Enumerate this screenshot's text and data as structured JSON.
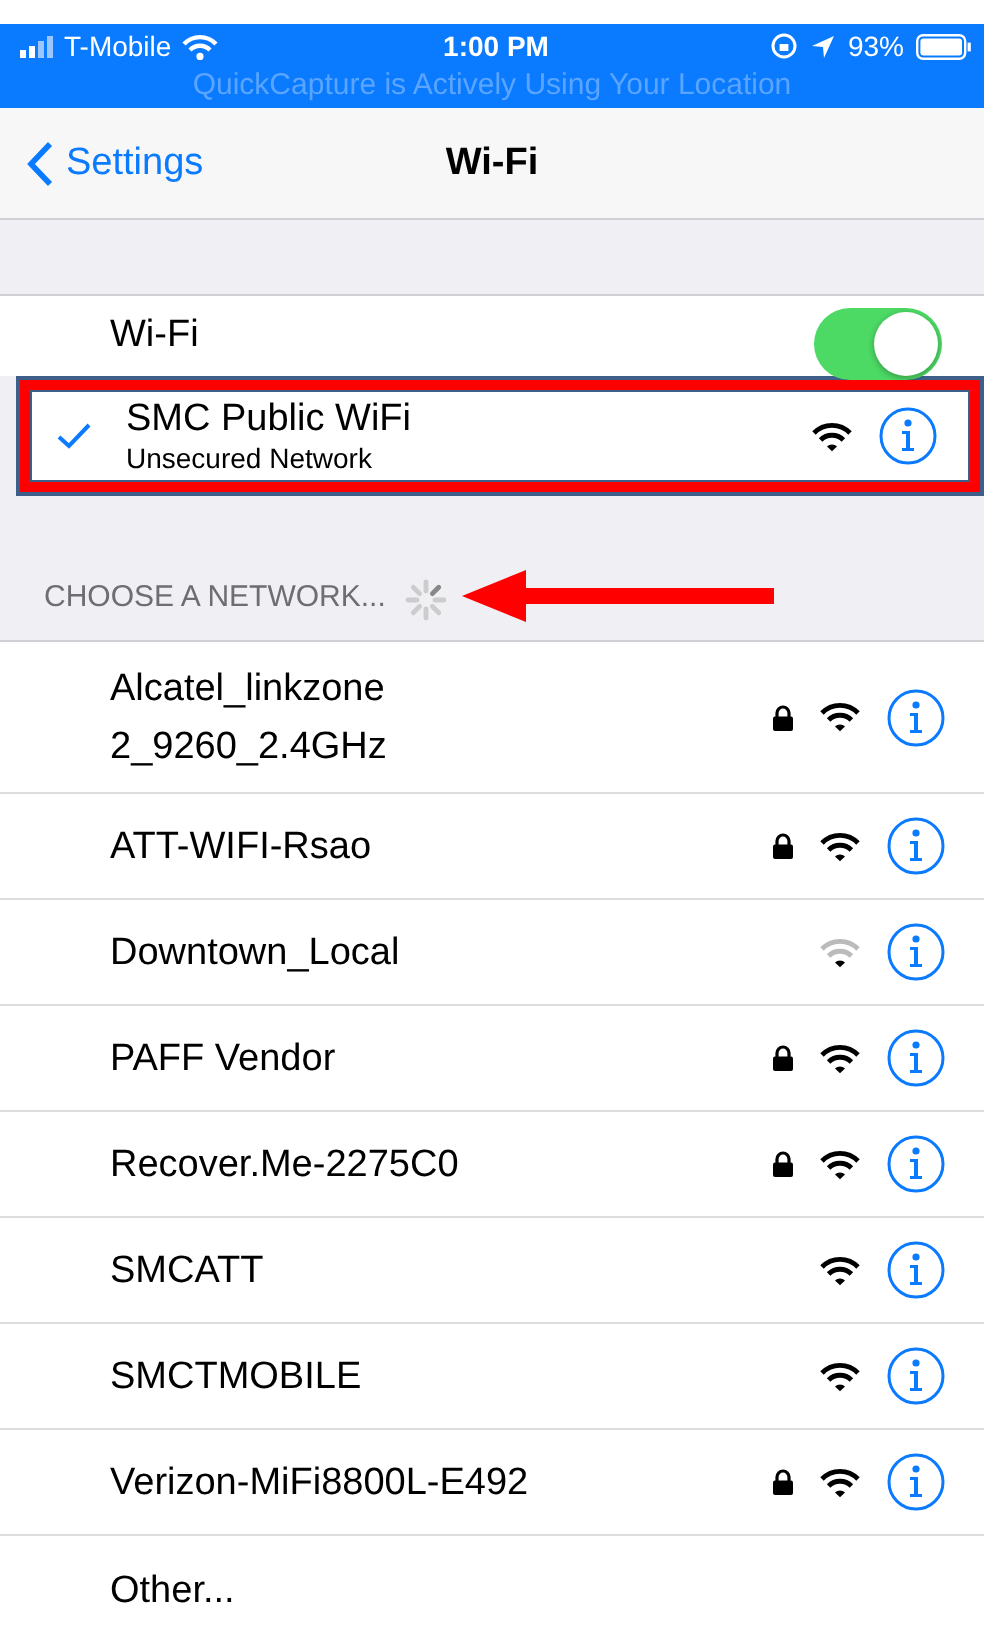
{
  "status_bar": {
    "carrier": "T-Mobile",
    "time": "1:00 PM",
    "battery": "93%"
  },
  "location_banner": "QuickCapture is Actively Using Your Location",
  "nav": {
    "back": "Settings",
    "title": "Wi-Fi"
  },
  "wifi_toggle": {
    "label": "Wi-Fi",
    "on": true
  },
  "connected": {
    "name": "SMC Public WiFi",
    "subtitle": "Unsecured Network",
    "checked": true,
    "weak": false
  },
  "section_header": "CHOOSE A NETWORK...",
  "networks": [
    {
      "name": "Alcatel_linkzone 2_9260_2.4GHz",
      "secured": true,
      "weak": false
    },
    {
      "name": "ATT-WIFI-Rsao",
      "secured": true,
      "weak": false
    },
    {
      "name": "Downtown_Local",
      "secured": false,
      "weak": true
    },
    {
      "name": "PAFF Vendor",
      "secured": true,
      "weak": false
    },
    {
      "name": "Recover.Me-2275C0",
      "secured": true,
      "weak": false
    },
    {
      "name": "SMCATT",
      "secured": false,
      "weak": false
    },
    {
      "name": "SMCTMOBILE",
      "secured": false,
      "weak": false
    },
    {
      "name": "Verizon-MiFi8800L-E492",
      "secured": true,
      "weak": false
    }
  ],
  "other": "Other..."
}
